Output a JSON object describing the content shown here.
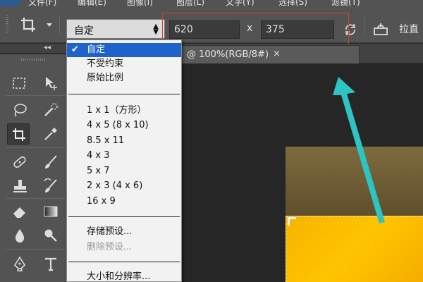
{
  "menubar": {
    "items": [
      "文件(F)",
      "编辑(E)",
      "图像(I)",
      "图层(L)",
      "文字(Y)",
      "选择(S)",
      "滤镜(T)"
    ]
  },
  "options_bar": {
    "tool_icon": "crop-icon",
    "ratio_value": "自定",
    "width_value": "620",
    "separator": "x",
    "height_value": "375",
    "swap_icon": "swap-arrows-icon",
    "straighten_icon": "level-icon",
    "straighten_label": "拉直"
  },
  "tool_panel": {
    "collapse_label": "◂◂",
    "tools": [
      "rect-marquee-icon",
      "move-icon",
      "lasso-icon",
      "quick-select-icon",
      "crop-icon",
      "eyedropper-icon",
      "healing-brush-icon",
      "brush-icon",
      "clone-stamp-icon",
      "history-brush-icon",
      "eraser-icon",
      "gradient-icon",
      "blur-icon",
      "dodge-icon",
      "pen-icon",
      "type-icon"
    ]
  },
  "document": {
    "tab_title": "@ 100%(RGB/8#)",
    "tab_close": "×"
  },
  "dropdown": {
    "group1": [
      {
        "label": "自定",
        "selected": true
      },
      {
        "label": "不受约束",
        "selected": false
      },
      {
        "label": "原始比例",
        "selected": false
      }
    ],
    "group2": [
      "1 x 1（方形）",
      "4 x 5 (8 x 10)",
      "8.5 x 11",
      "4 x 3",
      "5 x 7",
      "2 x 3 (4 x 6)",
      "16 x 9"
    ],
    "group3": [
      {
        "label": "存储预设...",
        "disabled": false
      },
      {
        "label": "删除预设...",
        "disabled": true
      }
    ],
    "group4": [
      {
        "label": "大小和分辨率...",
        "disabled": false
      }
    ]
  },
  "colors": {
    "selection_blue": "#1e63c9",
    "annotation_red": "#d6403f",
    "annotation_arrow": "#2ec4c4",
    "image_yellow": "#ffc400"
  }
}
